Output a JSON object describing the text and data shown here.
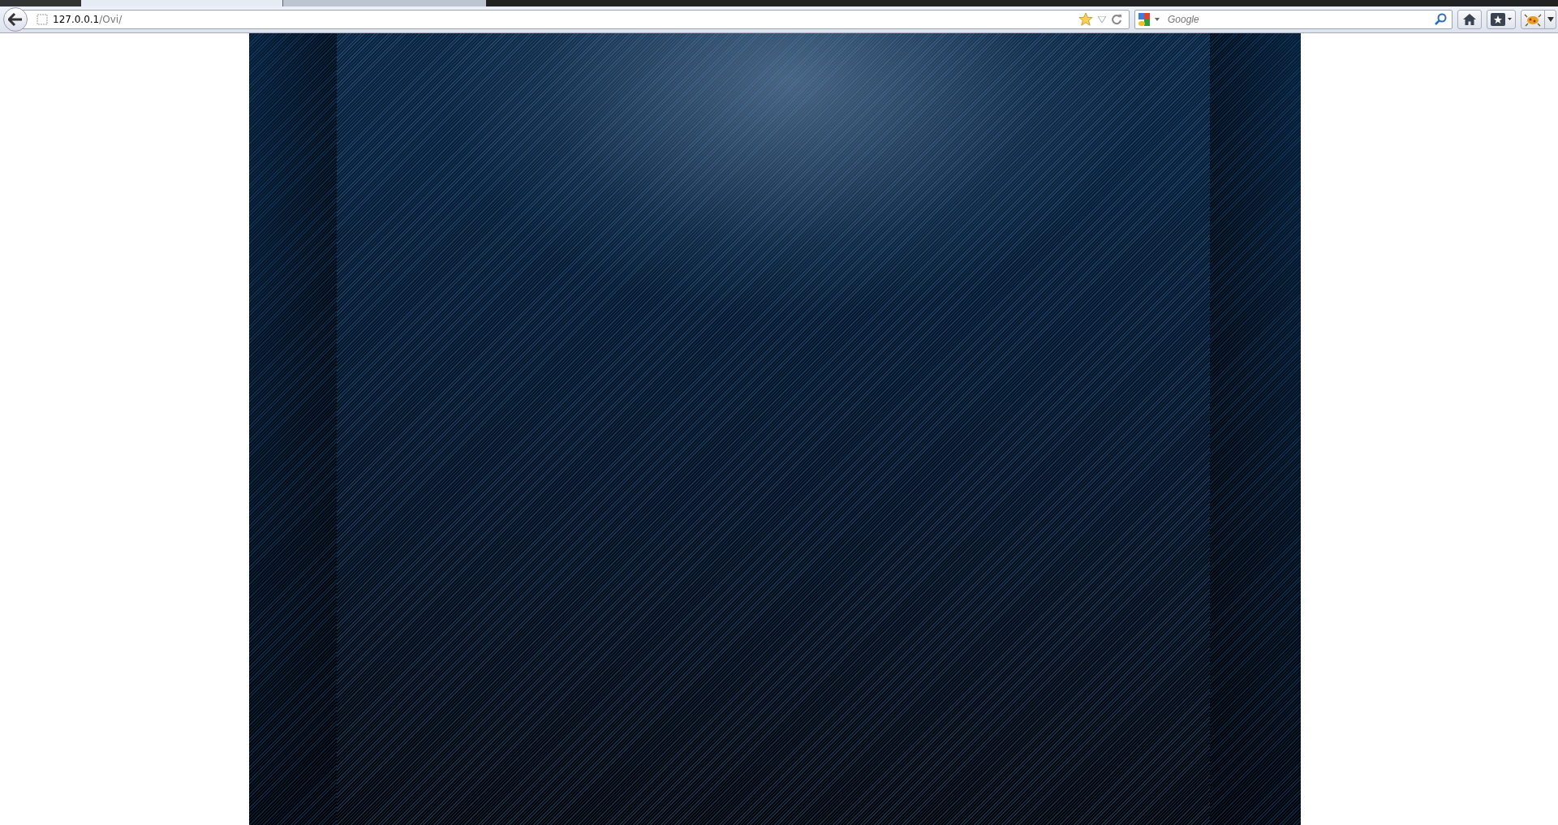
{
  "toolbar": {
    "url": {
      "host": "127.0.0.1",
      "path": "/Ovi/"
    },
    "search": {
      "placeholder": "Google"
    }
  },
  "page": {
    "kind": "blank-dark-panel"
  }
}
